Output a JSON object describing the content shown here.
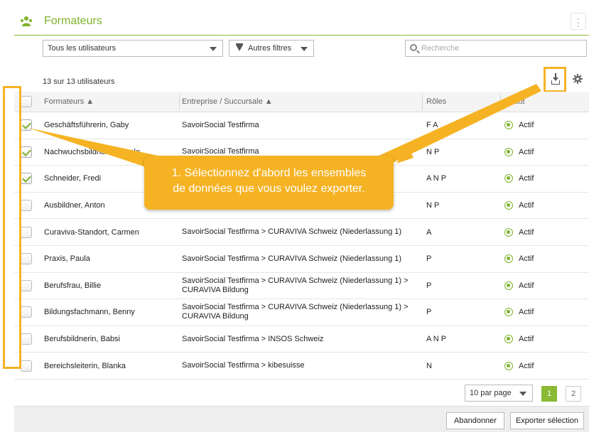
{
  "header": {
    "title": "Formateurs"
  },
  "filters": {
    "users_select": "Tous les utilisateurs",
    "more_filters": "Autres filtres",
    "search_placeholder": "Recherche"
  },
  "count_text": "13 sur 13 utilisateurs",
  "columns": {
    "trainers": "Formateurs ▲",
    "company": "Entreprise / Succursale ▲",
    "roles": "Rôles",
    "status": "Statut"
  },
  "rows": [
    {
      "name": "Geschäftsführerin, Gaby",
      "company": "SavoirSocial Testfirma",
      "roles": "F A",
      "status": "Actif",
      "checked": true
    },
    {
      "name": "Nachwuchsbildnerin, Nicole",
      "company": "SavoirSocial Testfirma",
      "roles": "N P",
      "status": "Actif",
      "checked": true
    },
    {
      "name": "Schneider, Fredi",
      "company": "",
      "roles": "A N P",
      "status": "Actif",
      "checked": true
    },
    {
      "name": "Ausbildner, Anton",
      "company": "",
      "roles": "N P",
      "status": "Actif",
      "checked": false
    },
    {
      "name": "Curaviva-Standort, Carmen",
      "company": "SavoirSocial Testfirma > CURAVIVA Schweiz (Niederlassung 1)",
      "roles": "A",
      "status": "Actif",
      "checked": false
    },
    {
      "name": "Praxis, Paula",
      "company": "SavoirSocial Testfirma > CURAVIVA Schweiz (Niederlassung 1)",
      "roles": "P",
      "status": "Actif",
      "checked": false
    },
    {
      "name": "Berufsfrau, Billie",
      "company": "SavoirSocial Testfirma > CURAVIVA Schweiz (Niederlassung 1) > CURAVIVA Bildung",
      "roles": "P",
      "status": "Actif",
      "checked": false
    },
    {
      "name": "Bildungsfachmann, Benny",
      "company": "SavoirSocial Testfirma > CURAVIVA Schweiz (Niederlassung 1) > CURAVIVA Bildung",
      "roles": "P",
      "status": "Actif",
      "checked": false
    },
    {
      "name": "Berufsbildnerin, Babsi",
      "company": "SavoirSocial Testfirma > INSOS Schweiz",
      "roles": "A N P",
      "status": "Actif",
      "checked": false
    },
    {
      "name": "Bereichsleiterin, Blanka",
      "company": "SavoirSocial Testfirma > kibesuisse",
      "roles": "N",
      "status": "Actif",
      "checked": false
    }
  ],
  "pagination": {
    "per_page": "10 par page",
    "pages": [
      "1",
      "2"
    ],
    "current": "1"
  },
  "footer": {
    "cancel": "Abandonner",
    "export": "Exporter sélection"
  },
  "tooltip": {
    "line1": "1. Sélectionnez d'abord les ensembles",
    "line2": "de données que vous voulez exporter."
  },
  "colors": {
    "brand_green": "#7fb32c",
    "highlight_orange": "#f5b324"
  }
}
